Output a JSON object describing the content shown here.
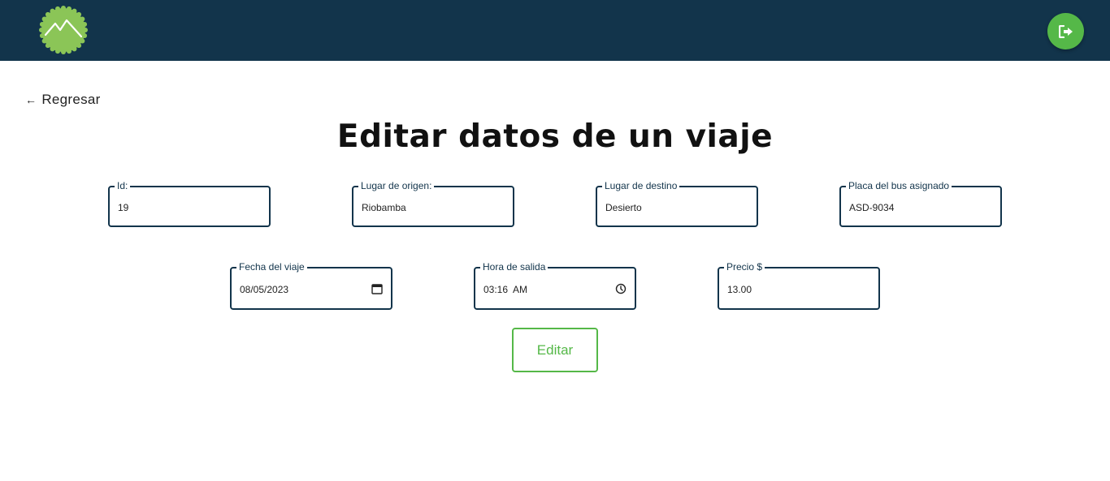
{
  "header": {
    "logo_icon": "mountain-badge-icon",
    "logout_icon": "sign-out-icon",
    "brand_color": "#12344b",
    "accent_color": "#55b848"
  },
  "back_link": {
    "label": "Regresar",
    "icon": "arrow-left-icon"
  },
  "page_title": "Editar datos de un viaje",
  "form": {
    "id": {
      "label": "Id:",
      "value": "19"
    },
    "origin": {
      "label": "Lugar de origen:",
      "value": "Riobamba"
    },
    "destination": {
      "label": "Lugar de destino",
      "value": "Desierto"
    },
    "bus_plate": {
      "label": "Placa del bus asignado",
      "value": "ASD-9034"
    },
    "date": {
      "label": "Fecha del viaje",
      "value": "08/05/2023",
      "icon": "calendar-icon"
    },
    "departure_time": {
      "label": "Hora de salida",
      "value": "03:16  AM",
      "icon": "clock-icon"
    },
    "price": {
      "label": "Precio $",
      "value": "13.00"
    },
    "submit_label": "Editar"
  }
}
